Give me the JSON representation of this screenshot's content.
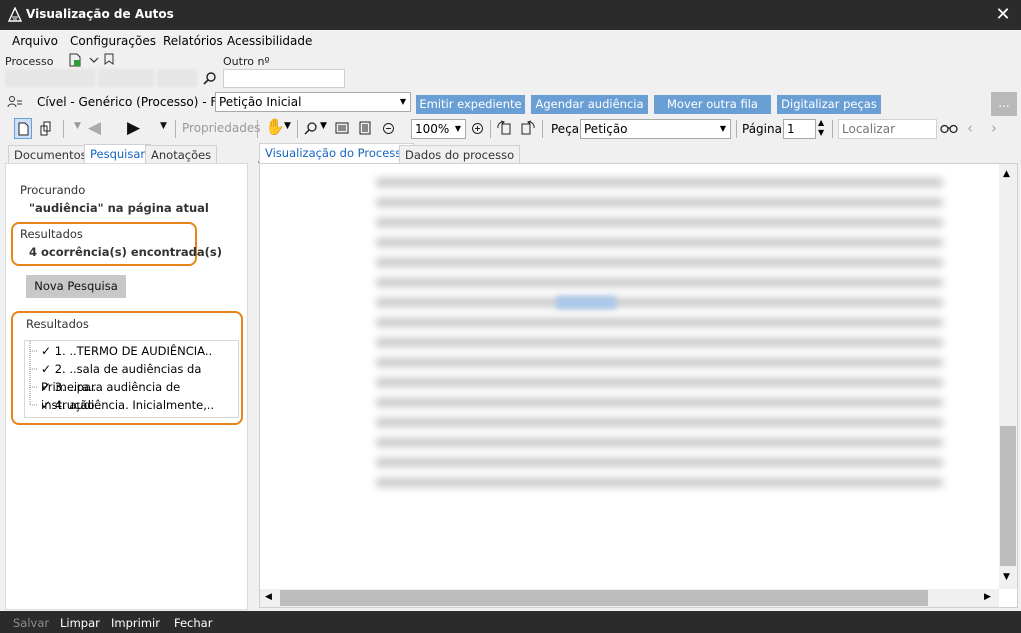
{
  "window": {
    "title": "Visualização de Autos",
    "close_icon": "close-icon"
  },
  "menu": [
    "Arquivo",
    "Configurações",
    "Relatórios",
    "Acessibilidade"
  ],
  "process": {
    "label": "Processo",
    "other_label": "Outro nº",
    "other_value": ""
  },
  "fila": {
    "class_text": "Cível - Genérico (Processo) - Fila:",
    "selected": "Petição Inicial",
    "buttons": [
      "Emitir expediente",
      "Agendar audiência",
      "Mover outra fila",
      "Digitalizar peças"
    ],
    "more_label": "..."
  },
  "toolbar": {
    "properties_label": "Propriedades",
    "zoom": "100%",
    "peca_label": "Peça",
    "peca_value": "Petição",
    "pagina_label": "Página",
    "pagina_value": "1",
    "localizar_placeholder": "Localizar"
  },
  "left_tabs": [
    "Documentos",
    "Pesquisar",
    "Anotações"
  ],
  "search": {
    "searching_label": "Procurando",
    "query_text": "\"audiência\" na página atual",
    "results_label": "Resultados",
    "results_count": "4 ocorrência(s) encontrada(s)",
    "new_search_label": "Nova Pesquisa",
    "results_box_label": "Resultados",
    "results": [
      "1. ..TERMO DE AUDIÊNCIA..",
      "2. ..sala de audiências da Primeira..",
      "3. ..para audiência de instrução..",
      "4. audiência. Inicialmente,.."
    ]
  },
  "doc_tabs": [
    "Visualização do Processo",
    "Dados do processo"
  ],
  "bottom": {
    "salvar": "Salvar",
    "limpar": "Limpar",
    "imprimir": "Imprimir",
    "fechar": "Fechar"
  },
  "colors": {
    "accent": "#6a9fd6",
    "highlight": "#e8831b",
    "titlebar": "#2b2b2b"
  }
}
